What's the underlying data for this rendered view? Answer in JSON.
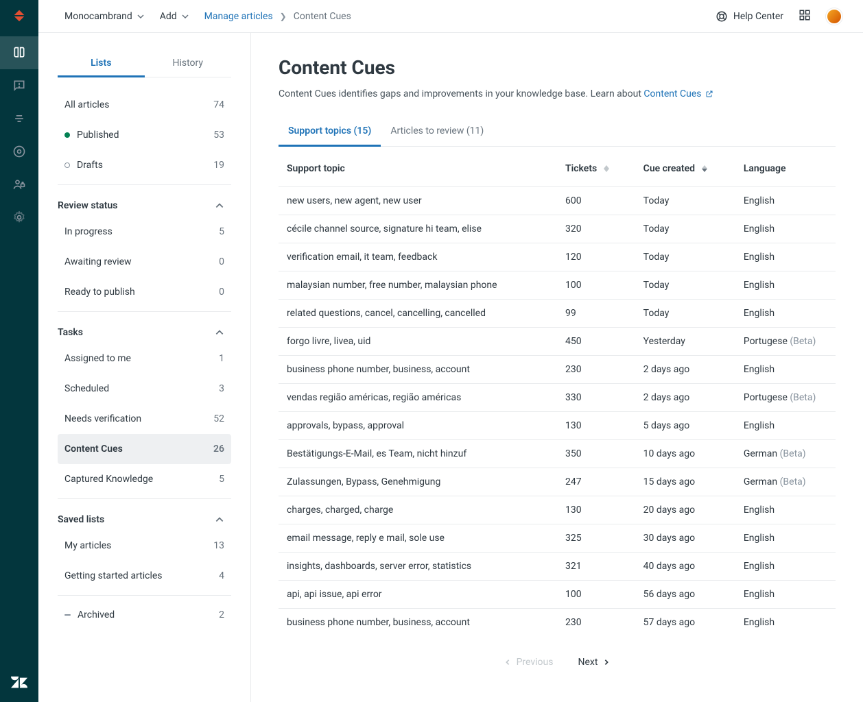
{
  "topbar": {
    "workspace": "Monocambrand",
    "add": "Add",
    "breadcrumb_link": "Manage articles",
    "breadcrumb_current": "Content Cues",
    "help_center": "Help Center"
  },
  "side_tabs": {
    "lists": "Lists",
    "history": "History"
  },
  "article_lists": [
    {
      "label": "All articles",
      "count": "74",
      "dot": ""
    },
    {
      "label": "Published",
      "count": "53",
      "dot": "green"
    },
    {
      "label": "Drafts",
      "count": "19",
      "dot": "hollow"
    }
  ],
  "sections": {
    "review_status": {
      "header": "Review status",
      "items": [
        {
          "label": "In progress",
          "count": "5"
        },
        {
          "label": "Awaiting review",
          "count": "0"
        },
        {
          "label": "Ready to publish",
          "count": "0"
        }
      ]
    },
    "tasks": {
      "header": "Tasks",
      "items": [
        {
          "label": "Assigned to me",
          "count": "1"
        },
        {
          "label": "Scheduled",
          "count": "3"
        },
        {
          "label": "Needs verification",
          "count": "52"
        },
        {
          "label": "Content Cues",
          "count": "26",
          "selected": true
        },
        {
          "label": "Captured Knowledge",
          "count": "5"
        }
      ]
    },
    "saved_lists": {
      "header": "Saved lists",
      "items": [
        {
          "label": "My articles",
          "count": "13"
        },
        {
          "label": "Getting started articles",
          "count": "4"
        }
      ]
    },
    "archived": {
      "label": "Archived",
      "count": "2",
      "dot": "dash"
    }
  },
  "content": {
    "title": "Content Cues",
    "subtitle_text": "Content Cues identifies gaps and improvements in your knowledge base. Learn about ",
    "subtitle_link": "Content Cues",
    "tabs": {
      "support_topics": "Support topics (15)",
      "articles_to_review": "Articles to review (11)"
    },
    "headers": {
      "topic": "Support topic",
      "tickets": "Tickets",
      "created": "Cue created",
      "language": "Language"
    },
    "rows": [
      {
        "topic": "new users, new agent, new user",
        "tickets": "600",
        "created": "Today",
        "lang": "English",
        "beta": ""
      },
      {
        "topic": "cécile channel source, signature hi team, elise",
        "tickets": "320",
        "created": "Today",
        "lang": "English",
        "beta": ""
      },
      {
        "topic": "verification email, it team, feedback",
        "tickets": "120",
        "created": "Today",
        "lang": "English",
        "beta": ""
      },
      {
        "topic": "malaysian number, free number, malaysian phone",
        "tickets": "100",
        "created": "Today",
        "lang": "English",
        "beta": ""
      },
      {
        "topic": "related questions, cancel, cancelling, cancelled",
        "tickets": "99",
        "created": "Today",
        "lang": "English",
        "beta": ""
      },
      {
        "topic": "forgo livre, livea, uid",
        "tickets": "450",
        "created": "Yesterday",
        "lang": "Portugese",
        "beta": " (Beta)"
      },
      {
        "topic": "business phone number, business, account",
        "tickets": "230",
        "created": "2 days ago",
        "lang": "English",
        "beta": ""
      },
      {
        "topic": "vendas região américas, região américas",
        "tickets": "330",
        "created": "2 days ago",
        "lang": "Portugese",
        "beta": " (Beta)"
      },
      {
        "topic": "approvals, bypass, approval",
        "tickets": "130",
        "created": "5 days ago",
        "lang": "English",
        "beta": ""
      },
      {
        "topic": "Bestätigungs-E-Mail, es Team, nicht hinzuf",
        "tickets": "350",
        "created": "10 days ago",
        "lang": "German",
        "beta": " (Beta)"
      },
      {
        "topic": "Zulassungen, Bypass, Genehmigung",
        "tickets": "247",
        "created": "15 days ago",
        "lang": "German",
        "beta": " (Beta)"
      },
      {
        "topic": "charges, charged, charge",
        "tickets": "130",
        "created": "20 days ago",
        "lang": "English",
        "beta": ""
      },
      {
        "topic": "email message, reply e mail, sole use",
        "tickets": "325",
        "created": "30 days ago",
        "lang": "English",
        "beta": ""
      },
      {
        "topic": "insights, dashboards, server error, statistics",
        "tickets": "321",
        "created": "40 days ago",
        "lang": "English",
        "beta": ""
      },
      {
        "topic": "api, api issue, api error",
        "tickets": "100",
        "created": "56 days ago",
        "lang": "English",
        "beta": ""
      },
      {
        "topic": "business phone number, business, account",
        "tickets": "230",
        "created": "57 days ago",
        "lang": "English",
        "beta": ""
      }
    ],
    "pager": {
      "prev": "Previous",
      "next": "Next"
    }
  }
}
